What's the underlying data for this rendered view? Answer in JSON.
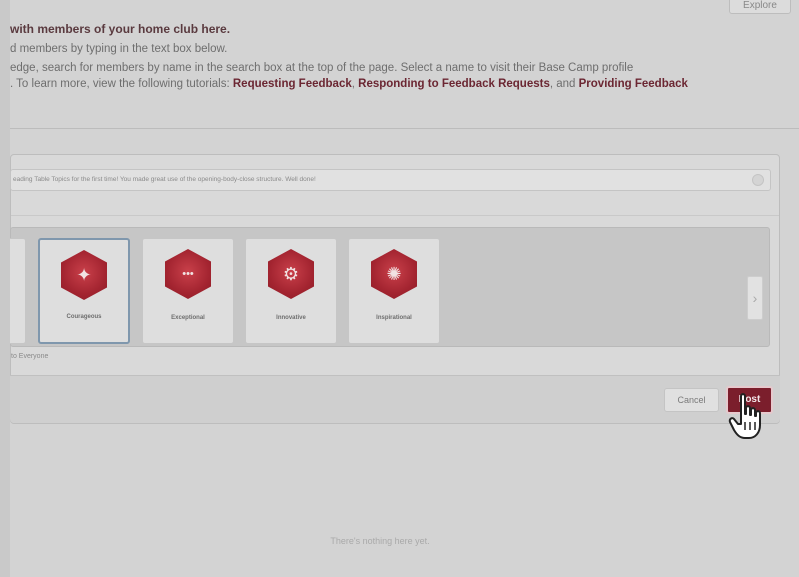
{
  "header": {
    "top_button_label": "Explore"
  },
  "intro": {
    "heading": "with members of your home club here.",
    "line2": "d members by typing in the text box below.",
    "line3": "edge, search for members by name in the search box at the top of the page. Select a name to visit their Base Camp profile",
    "line4_prefix": ". To learn more, view the following tutorials: ",
    "link1": "Requesting Feedback",
    "sep1": ", ",
    "link2": "Responding to Feedback Requests",
    "sep2": ", and ",
    "link3": "Providing Feedback"
  },
  "composer": {
    "message_text": "eading Table Topics for the first time! You made great use of the opening-body-close structure. Well done!",
    "badges": [
      {
        "name": "Courageous",
        "icon": "astronaut-icon",
        "glyph": "✦"
      },
      {
        "name": "Exceptional",
        "icon": "dots-line-icon",
        "glyph": "•••"
      },
      {
        "name": "Innovative",
        "icon": "head-gears-icon",
        "glyph": "⚙"
      },
      {
        "name": "Inspirational",
        "icon": "starburst-icon",
        "glyph": "✺"
      }
    ],
    "next_arrow": "›",
    "visibility_text": "to Everyone",
    "cancel_label": "Cancel",
    "post_label": "Post"
  },
  "feed": {
    "empty_text": "There's nothing here yet."
  },
  "colors": {
    "accent": "#7b1e2c",
    "badge_red": "#a32430",
    "selected_border": "#7f97ad"
  }
}
